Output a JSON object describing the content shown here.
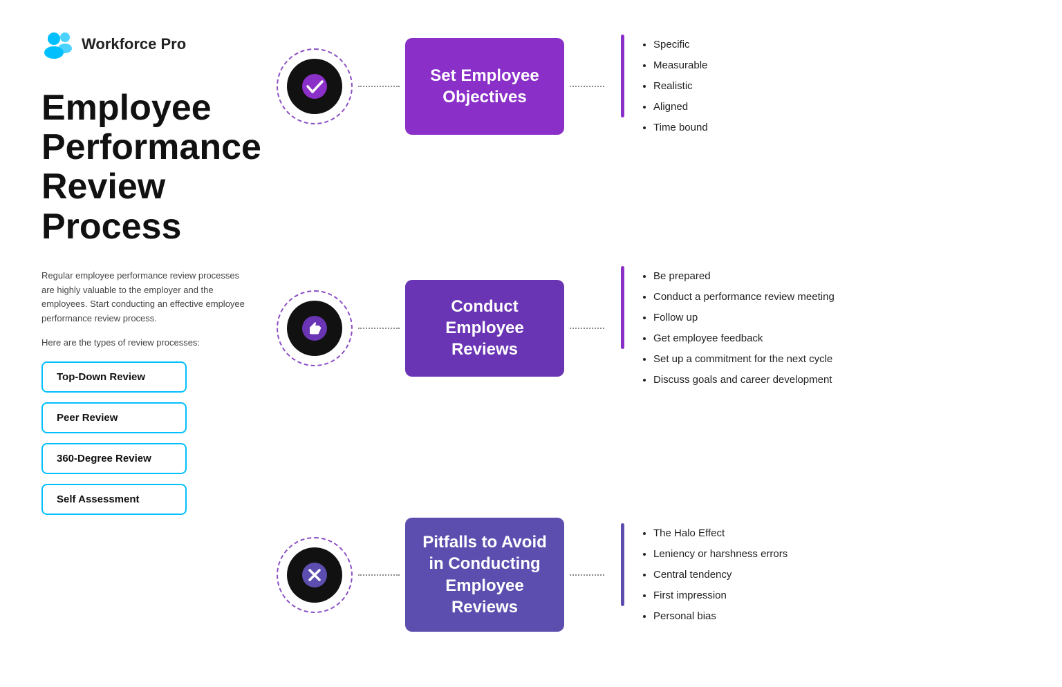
{
  "logo": {
    "text": "Workforce Pro"
  },
  "sidebar": {
    "main_title": "Employee Performance Review Process",
    "description1": "Regular employee performance review processes are highly valuable to the employer and the employees. Start conducting an effective employee performance review process.",
    "description2": "Here are the types of review processes:",
    "buttons": [
      "Top-Down Review",
      "Peer Review",
      "360-Degree Review",
      "Self Assessment"
    ]
  },
  "processes": [
    {
      "id": "set-objectives",
      "box_label": "Set Employee Objectives",
      "box_class": "box-purple",
      "bar_class": "",
      "icon": "check",
      "items": [
        "Specific",
        "Measurable",
        "Realistic",
        "Aligned",
        "Time bound"
      ]
    },
    {
      "id": "conduct-reviews",
      "box_label": "Conduct Employee Reviews",
      "box_class": "box-violet",
      "bar_class": "",
      "icon": "thumb",
      "items": [
        "Be prepared",
        "Conduct a performance review meeting",
        "Follow up",
        "Get employee feedback",
        "Set up a commitment for the next cycle",
        "Discuss goals and career development"
      ]
    },
    {
      "id": "pitfalls",
      "box_label": "Pitfalls to Avoid in Conducting Employee Reviews",
      "box_class": "box-indigo",
      "bar_class": "vertical-bar-indigo",
      "icon": "close",
      "items": [
        "The Halo Effect",
        "Leniency or harshness errors",
        "Central tendency",
        "First impression",
        "Personal bias"
      ]
    }
  ]
}
